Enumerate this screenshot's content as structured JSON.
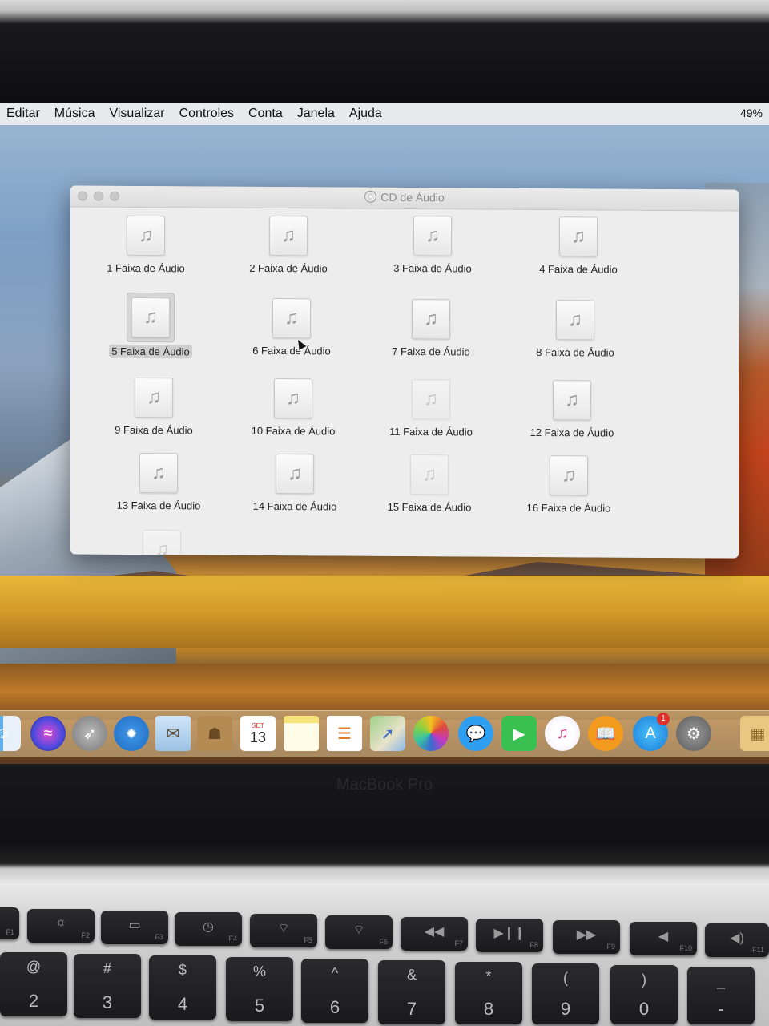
{
  "menubar": {
    "items": [
      "Editar",
      "Música",
      "Visualizar",
      "Controles",
      "Conta",
      "Janela",
      "Ajuda"
    ],
    "battery": "49%"
  },
  "window": {
    "title": "CD de Áudio",
    "tracks": [
      "1 Faixa de Áudio",
      "2 Faixa de Áudio",
      "3 Faixa de Áudio",
      "4 Faixa de Áudio",
      "5 Faixa de Áudio",
      "6 Faixa de Áudio",
      "7 Faixa de Áudio",
      "8 Faixa de Áudio",
      "9 Faixa de Áudio",
      "10 Faixa de Áudio",
      "11 Faixa de Áudio",
      "12 Faixa de Áudio",
      "13 Faixa de Áudio",
      "14 Faixa de Áudio",
      "15 Faixa de Áudio",
      "16 Faixa de Áudio"
    ],
    "selected_track": "5 Faixa de Áudio",
    "track_icon": "music-note-icon"
  },
  "dock": {
    "calendar": {
      "month": "SET",
      "day": "13"
    },
    "app_store_badge": "1",
    "icons": [
      "finder-icon",
      "siri-icon",
      "launchpad-icon",
      "safari-icon",
      "mail-icon",
      "contacts-icon",
      "calendar-icon",
      "notes-icon",
      "reminders-icon",
      "maps-icon",
      "photos-icon",
      "messages-icon",
      "facetime-icon",
      "itunes-icon",
      "ibooks-icon",
      "app-store-icon",
      "system-preferences-icon",
      "downloads-icon"
    ]
  },
  "laptop": {
    "brand": "MacBook Pro",
    "function_keys": [
      "F1",
      "F2",
      "F3",
      "F4",
      "F5",
      "F6",
      "F7",
      "F8",
      "F9",
      "F10",
      "F11"
    ],
    "number_keys": [
      {
        "top": "@",
        "bottom": "2"
      },
      {
        "top": "#",
        "bottom": "3"
      },
      {
        "top": "$",
        "bottom": "4"
      },
      {
        "top": "%",
        "bottom": "5"
      },
      {
        "top": "^",
        "bottom": "6"
      },
      {
        "top": "&",
        "bottom": "7"
      },
      {
        "top": "*",
        "bottom": "8"
      },
      {
        "top": "(",
        "bottom": "9"
      },
      {
        "top": ")",
        "bottom": "0"
      },
      {
        "top": "_",
        "bottom": "-"
      }
    ]
  }
}
